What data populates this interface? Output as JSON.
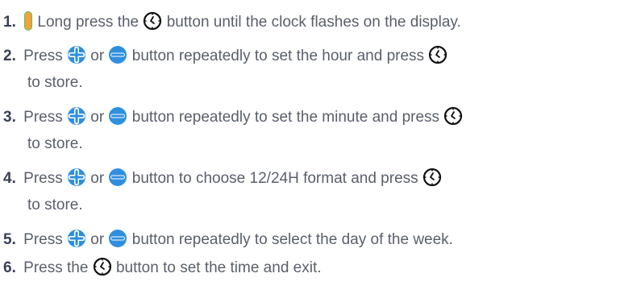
{
  "colors": {
    "text": "#5a5f6b",
    "number": "#3a3f55",
    "button_blue": "#2f8fde",
    "orange": "#f2a23a",
    "green": "#52c25e"
  },
  "icons": {
    "clock": "clock-button-icon",
    "plus": "plus-button-icon",
    "minus": "minus-button-icon",
    "indicator": "orange-green-indicator-icon"
  },
  "steps": [
    {
      "num": "1.",
      "a": "Long press the",
      "b": "button until the clock flashes on the display."
    },
    {
      "num": "2.",
      "a": "Press",
      "or": "or",
      "b": "button repeatedly to set the hour and press",
      "c": "to store."
    },
    {
      "num": "3.",
      "a": "Press",
      "or": "or",
      "b": "button repeatedly to set the minute and press",
      "c": "to store."
    },
    {
      "num": "4.",
      "a": "Press",
      "or": "or",
      "b": "button to choose 12/24H format and press",
      "c": "to store."
    },
    {
      "num": "5.",
      "a": "Press",
      "or": "or",
      "b": "button repeatedly to select the day of the week."
    },
    {
      "num": "6.",
      "a": "Press the",
      "b": "button to set the time and exit."
    }
  ]
}
